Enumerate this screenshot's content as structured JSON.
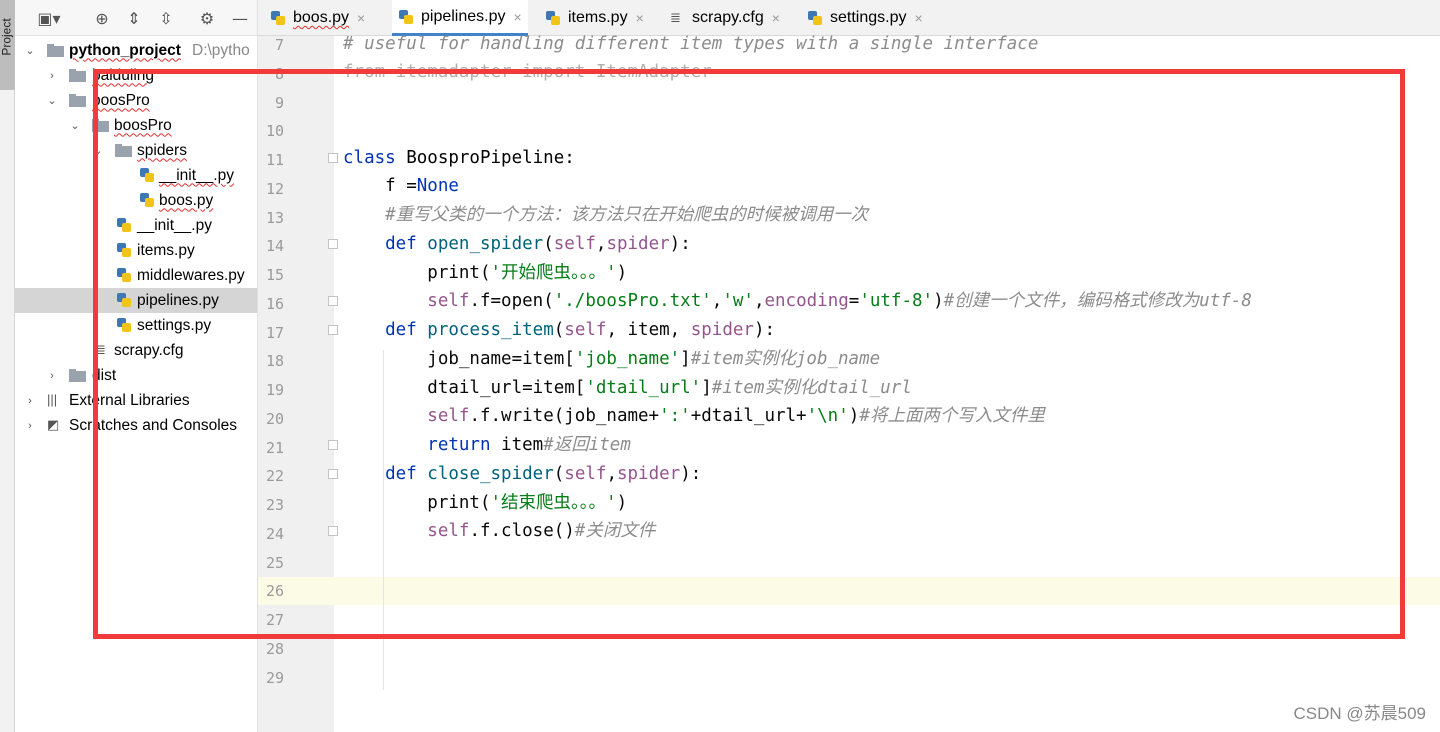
{
  "sidebar_tab": "Project",
  "project_tree": [
    {
      "label": "python_project",
      "extra": "D:\\pytho",
      "bold": true,
      "chevron": "down"
    },
    {
      "label": "baiduling",
      "chevron": "right"
    },
    {
      "label": "boosPro",
      "chevron": "down"
    },
    {
      "label": "boosPro",
      "chevron": "down"
    },
    {
      "label": "spiders",
      "chevron": "down"
    },
    {
      "label": "__init__.py"
    },
    {
      "label": "boos.py"
    },
    {
      "label": "__init__.py"
    },
    {
      "label": "items.py"
    },
    {
      "label": "middlewares.py"
    },
    {
      "label": "pipelines.py",
      "selected": true
    },
    {
      "label": "settings.py"
    },
    {
      "label": "scrapy.cfg"
    },
    {
      "label": "dist",
      "chevron": "right"
    },
    {
      "label": "External Libraries",
      "chevron": "right"
    },
    {
      "label": "Scratches and Consoles",
      "chevron": "right"
    }
  ],
  "tabs": [
    {
      "label": "boos.py",
      "icon": "python-file-icon"
    },
    {
      "label": "pipelines.py",
      "icon": "python-file-icon",
      "active": true
    },
    {
      "label": "items.py",
      "icon": "python-file-icon"
    },
    {
      "label": "scrapy.cfg",
      "icon": "config-file-icon"
    },
    {
      "label": "settings.py",
      "icon": "python-file-icon"
    }
  ],
  "tab_close_glyph": "×",
  "line_numbers": [
    "7",
    "8",
    "9",
    "10",
    "11",
    "12",
    "13",
    "14",
    "15",
    "16",
    "17",
    "18",
    "19",
    "20",
    "21",
    "22",
    "23",
    "24",
    "25",
    "26",
    "27",
    "28",
    "29"
  ],
  "code_lines": {
    "l7": "# useful for handling different item types with a single interface",
    "l8": "from itemadapter import ItemAdapter",
    "l11_kw": "class ",
    "l11_name": "BoosproPipeline:",
    "l12_a": "    f =",
    "l12_b": "None",
    "l13": "    #重写父类的一个方法：该方法只在开始爬虫的时候被调用一次",
    "l14_kw": "    def ",
    "l14_fn": "open_spider",
    "l14_a": "(",
    "l14_self": "self",
    "l14_b": ",",
    "l14_c": "spider",
    "l14_d": "):",
    "l15_a": "        print(",
    "l15_str": "'开始爬虫。。。'",
    "l15_b": ")",
    "l16_self": "        self",
    "l16_a": ".f=open(",
    "l16_s1": "'./boosPro.txt'",
    "l16_b": ",",
    "l16_s2": "'w'",
    "l16_c": ",",
    "l16_kw": "encoding",
    "l16_d": "=",
    "l16_s3": "'utf-8'",
    "l16_e": ")",
    "l16_cmt": "#创建一个文件，编码格式修改为utf-8",
    "l17_kw": "    def ",
    "l17_fn": "process_item",
    "l17_a": "(",
    "l17_self": "self",
    "l17_b": ", item, ",
    "l17_c": "spider",
    "l17_d": "):",
    "l18_a": "        job_name=item[",
    "l18_str": "'job_name'",
    "l18_b": "]",
    "l18_cmt": "#item实例化job_name",
    "l19_a": "        dtail_url=item[",
    "l19_str": "'dtail_url'",
    "l19_b": "]",
    "l19_cmt": "#item实例化dtail_url",
    "l20_self": "        self",
    "l20_a": ".f.write(job_name+",
    "l20_s1": "':'",
    "l20_b": "+dtail_url+",
    "l20_s2": "'\\n'",
    "l20_c": ")",
    "l20_cmt": "#将上面两个写入文件里",
    "l21_kw": "        return ",
    "l21_a": "item",
    "l21_cmt": "#返回item",
    "l22_kw": "    def ",
    "l22_fn": "close_spider",
    "l22_a": "(",
    "l22_self": "self",
    "l22_b": ",",
    "l22_c": "spider",
    "l22_d": "):",
    "l23_a": "        print(",
    "l23_str": "'结束爬虫。。。'",
    "l23_b": ")",
    "l24_self": "        self",
    "l24_a": ".f.close()",
    "l24_cmt": "#关闭文件"
  },
  "watermark": "CSDN @苏晨509",
  "colors": {
    "annotation_red": "#f23a3a",
    "tab_active_underline": "#4083c9"
  }
}
